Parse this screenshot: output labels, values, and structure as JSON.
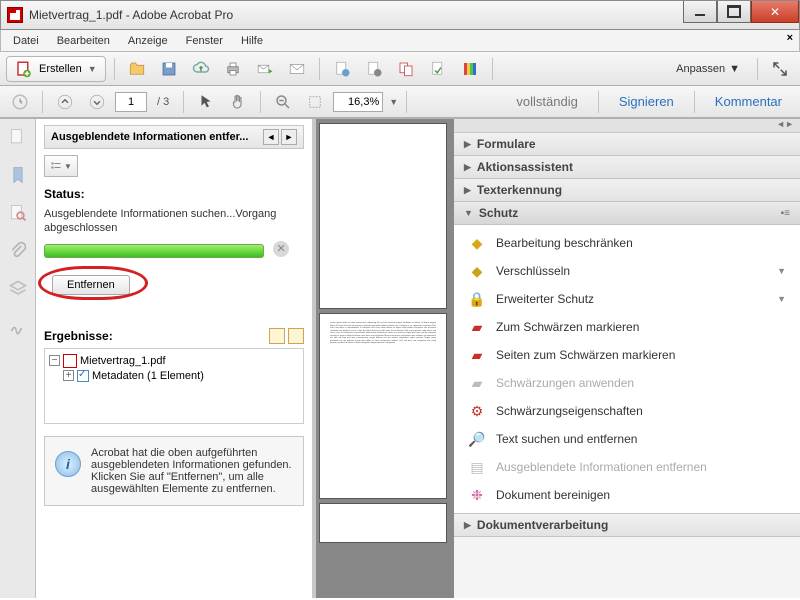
{
  "titlebar": {
    "title": "Mietvertrag_1.pdf - Adobe Acrobat Pro"
  },
  "menubar": {
    "items": [
      "Datei",
      "Bearbeiten",
      "Anzeige",
      "Fenster",
      "Hilfe"
    ]
  },
  "toolbar": {
    "create_label": "Erstellen",
    "page_current": "1",
    "page_total": "/ 3",
    "zoom": "16,3%",
    "fit_label": "vollständig",
    "customize_label": "Anpassen",
    "sign_label": "Signieren",
    "comment_label": "Kommentar"
  },
  "panel": {
    "title": "Ausgeblendete Informationen entfer...",
    "status_label": "Status:",
    "status_text": "Ausgeblendete Informationen suchen...Vorgang abgeschlossen",
    "remove_btn": "Entfernen",
    "results_label": "Ergebnisse:",
    "tree": {
      "file": "Mietvertrag_1.pdf",
      "meta": "Metadaten (1 Element)"
    },
    "info": "Acrobat hat die oben aufgeführten ausgeblendeten Informationen gefunden. Klicken Sie auf \"Entfernen\", um alle ausgewählten Elemente zu entfernen."
  },
  "accordion": {
    "formulare": "Formulare",
    "aktion": "Aktionsassistent",
    "ocr": "Texterkennung",
    "schutz": "Schutz",
    "dokver": "Dokumentverarbeitung",
    "schutz_items": {
      "restrict": "Bearbeitung beschränken",
      "encrypt": "Verschlüsseln",
      "advanced": "Erweiterter Schutz",
      "mark_red": "Zum Schwärzen markieren",
      "mark_pages": "Seiten zum Schwärzen markieren",
      "apply_red": "Schwärzungen anwenden",
      "red_props": "Schwärzungseigenschaften",
      "search_remove": "Text suchen und entfernen",
      "hidden_remove": "Ausgeblendete Informationen entfernen",
      "sanitize": "Dokument bereinigen"
    }
  }
}
